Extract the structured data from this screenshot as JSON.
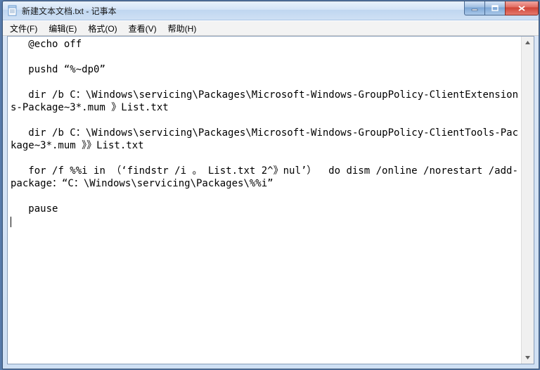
{
  "titlebar": {
    "title": "新建文本文档.txt - 记事本"
  },
  "menubar": {
    "file": "文件(F)",
    "edit": "编辑(E)",
    "format": "格式(O)",
    "view": "查看(V)",
    "help": "帮助(H)"
  },
  "editor": {
    "content": "   @echo off\n\n   pushd “%~dp0”\n\n   dir /b C：\\Windows\\servicing\\Packages\\Microsoft-Windows-GroupPolicy-ClientExtensions-Package~3*.mum 》List.txt\n\n   dir /b C：\\Windows\\servicing\\Packages\\Microsoft-Windows-GroupPolicy-ClientTools-Package~3*.mum 》》List.txt\n\n   for /f %%i in （‘findstr /i 。 List.txt 2^》nul’）  do dism /online /norestart /add-package：“C：\\Windows\\servicing\\Packages\\%%i”\n\n   pause"
  }
}
